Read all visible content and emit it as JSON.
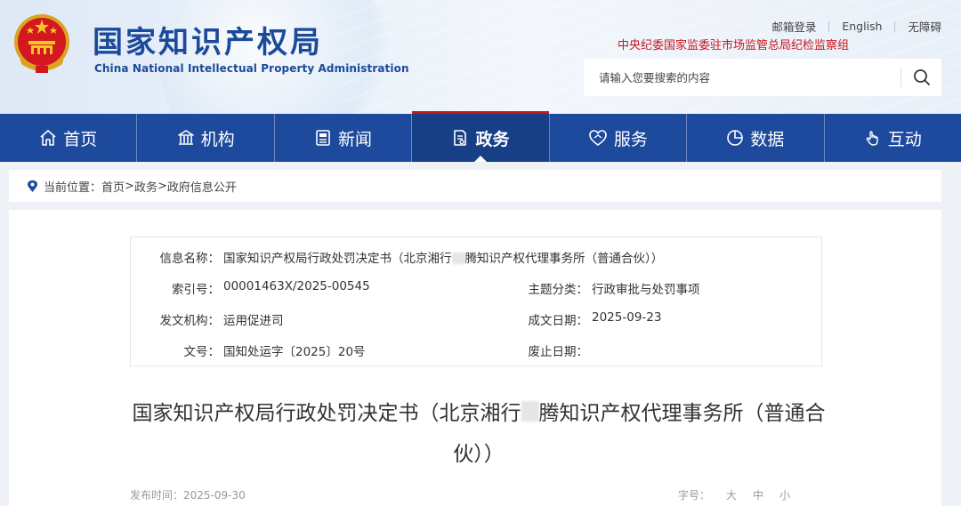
{
  "header": {
    "logo_cn": "国家知识产权局",
    "logo_en": "China National Intellectual Property Administration",
    "links": [
      "邮箱登录",
      "English",
      "无障碍"
    ],
    "discipline_text": "中央纪委国家监委驻市场监管总局纪检监察组",
    "search": {
      "placeholder": "请输入您要搜索的内容",
      "value": ""
    }
  },
  "nav": {
    "items": [
      {
        "label": "首页",
        "icon": "home-icon",
        "active": false
      },
      {
        "label": "机构",
        "icon": "institution-icon",
        "active": false
      },
      {
        "label": "新闻",
        "icon": "news-icon",
        "active": false
      },
      {
        "label": "政务",
        "icon": "affairs-icon",
        "active": true
      },
      {
        "label": "服务",
        "icon": "service-icon",
        "active": false
      },
      {
        "label": "数据",
        "icon": "data-icon",
        "active": false
      },
      {
        "label": "互动",
        "icon": "interact-icon",
        "active": false
      }
    ]
  },
  "breadcrumb": {
    "prefix": "当前位置：",
    "items": [
      "首页",
      "政务",
      "政府信息公开"
    ],
    "separator": ">"
  },
  "info": {
    "name_label": "信息名称：",
    "name_value_a": "国家知识产权局行政处罚决定书（北京湘行",
    "name_value_b": "腾知识产权代理事务所（普通合伙））",
    "index_label": "索引号：",
    "index_value": "00001463X/2025-00545",
    "topic_label": "主题分类：",
    "topic_value": "行政审批与处罚事项",
    "issuer_label": "发文机构：",
    "issuer_value": "运用促进司",
    "date_label": "成文日期：",
    "date_value": "2025-09-23",
    "docno_label": "文号：",
    "docno_value": "国知处运字〔2025〕20号",
    "expiry_label": "废止日期：",
    "expiry_value": ""
  },
  "article": {
    "title_a": "国家知识产权局行政处罚决定书（北京湘行",
    "title_b": "腾知识产权代理事务所（普通合伙））",
    "publish_label": "发布时间：",
    "publish_date": "2025-09-30",
    "fontsize_label": "字号：",
    "fontsize_options": [
      "大",
      "中",
      "小"
    ]
  },
  "colors": {
    "nav_bg": "#1d4a9c",
    "nav_active_bg": "#173f86",
    "accent_red": "#c8161d",
    "brand_blue": "#1b4a9a"
  }
}
